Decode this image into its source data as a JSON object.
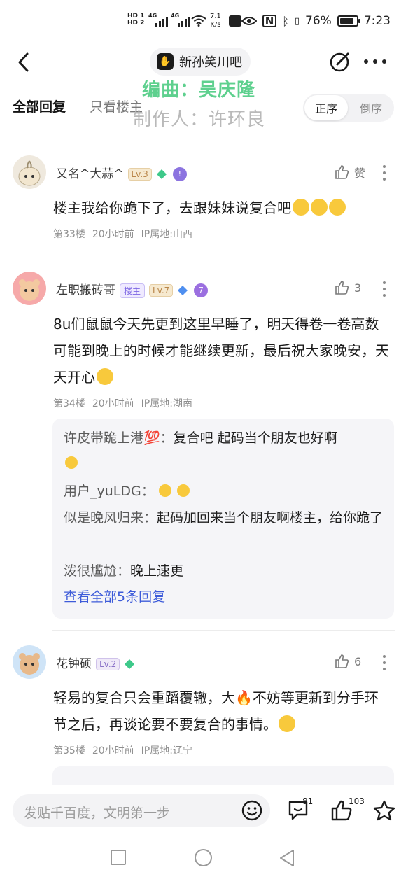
{
  "status_bar": {
    "sim1": "HD 1",
    "sim2": "HD 2",
    "net1": "4G",
    "net2": "4G",
    "speed_value": "7.1",
    "speed_unit": "K/s",
    "battery": "76%",
    "time": "7:23"
  },
  "header": {
    "forum_name": "新孙笑川吧"
  },
  "overlay": {
    "line1": "编曲：吴庆隆",
    "line2": "制作人：许环良"
  },
  "tabs": {
    "all": "全部回复",
    "op_only": "只看楼主",
    "order_asc": "正序",
    "order_desc": "倒序"
  },
  "posts": [
    {
      "username": "又名^大蒜^",
      "level": "Lv.3",
      "like_label": "赞",
      "text": "楼主我给你跪下了，去跟妹妹说复合吧",
      "floor": "第33楼",
      "time": "20小时前",
      "ip": "IP属地:山西"
    },
    {
      "username": "左职搬砖哥",
      "op_badge": "楼主",
      "level": "Lv.7",
      "medal": "7",
      "like_label": "3",
      "text": "8u们鼠鼠今天先更到这里早睡了，明天得卷一卷高数可能到晚上的时候才能继续更新，最后祝大家晚安，天天开心",
      "floor": "第34楼",
      "time": "20小时前",
      "ip": "IP属地:湖南",
      "replies": [
        {
          "name": "许皮带跪上港💯：",
          "text": "复合吧 起码当个朋友也好啊"
        },
        {
          "name": "用户_yuLDG：",
          "text": ""
        },
        {
          "name": "似是晚风归来：",
          "text": "起码加回来当个朋友啊楼主，给你跪了"
        },
        {
          "name": "泼很尴尬：",
          "text": "晚上速更"
        }
      ],
      "more_replies": "查看全部5条回复"
    },
    {
      "username": "花钟硕",
      "level": "Lv.2",
      "like_label": "6",
      "text": "轻易的复合只会重蹈覆辙，大🔥不妨等更新到分手环节之后，再谈论要不要复合的事情。",
      "floor": "第35楼",
      "time": "20小时前",
      "ip": "IP属地:辽宁"
    }
  ],
  "bottom_bar": {
    "input_placeholder": "发贴千百度，文明第一步",
    "comment_count": "81",
    "like_count": "103"
  }
}
